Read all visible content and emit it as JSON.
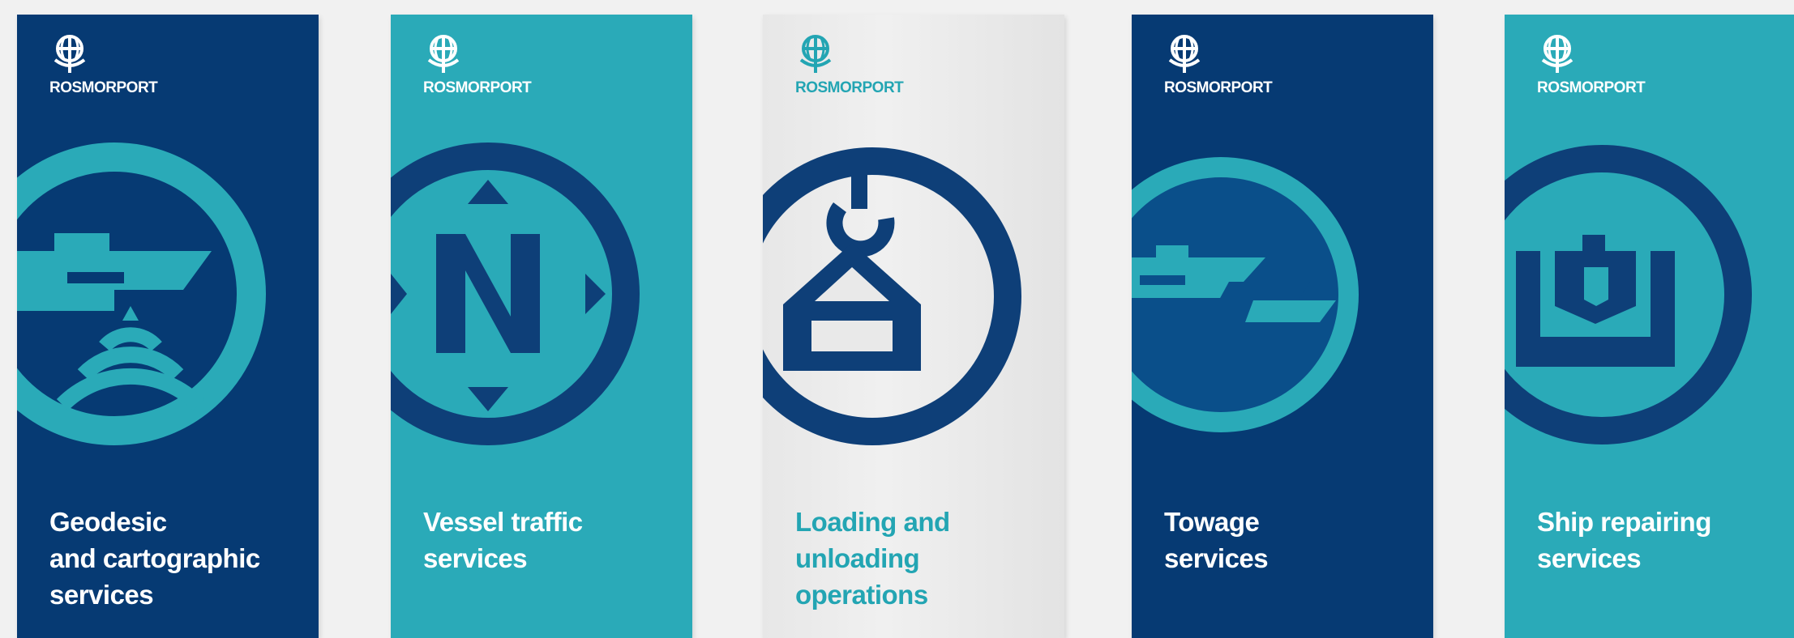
{
  "brand": "ROSMORPORT",
  "colors": {
    "navy": "#063a73",
    "teal": "#2aaab8",
    "light_gray": "#ececec",
    "white": "#ffffff"
  },
  "brochures": [
    {
      "title": "Geodesic\nand cartographic\nservices",
      "icon": "survey-ship-sonar-icon",
      "background": "navy"
    },
    {
      "title": "Vessel traffic\nservices",
      "icon": "compass-north-icon",
      "background": "teal"
    },
    {
      "title": "Loading and\nunloading\noperations",
      "icon": "crane-hook-cargo-icon",
      "background": "light_gray"
    },
    {
      "title": "Towage\nservices",
      "icon": "tug-boat-icon",
      "background": "navy"
    },
    {
      "title": "Ship repairing\nservices",
      "icon": "dry-dock-ship-icon",
      "background": "teal"
    }
  ]
}
